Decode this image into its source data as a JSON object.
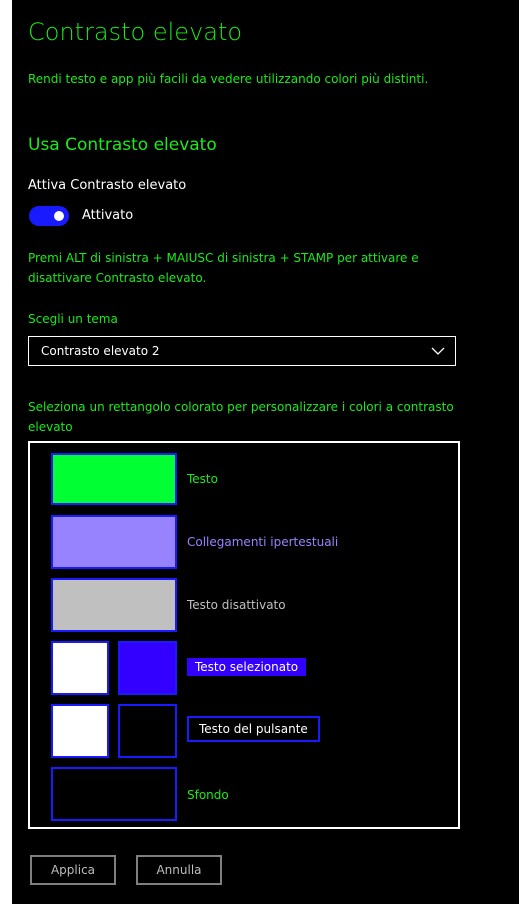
{
  "page": {
    "title": "Contrasto elevato",
    "subtitle": "Rendi testo e app più facili da vedere utilizzando colori più distinti."
  },
  "section": {
    "title": "Usa Contrasto elevato",
    "toggle_label": "Attiva Contrasto elevato",
    "toggle_state": "Attivato",
    "toggle_on": true,
    "shortcut_text": "Premi ALT di sinistra + MAIUSC di sinistra + STAMP per attivare e disattivare Contrasto elevato."
  },
  "theme": {
    "label": "Scegli un tema",
    "selected": "Contrasto elevato 2"
  },
  "colors": {
    "instructions": "Seleziona un rettangolo colorato per personalizzare i colori a contrasto elevato",
    "items": [
      {
        "label": "Testo",
        "swatches": [
          "#00ff33"
        ]
      },
      {
        "label": "Collegamenti ipertestuali",
        "swatches": [
          "#9883ff"
        ]
      },
      {
        "label": "Testo disattivato",
        "swatches": [
          "#c0c0c0"
        ]
      },
      {
        "label": "Testo selezionato",
        "swatches": [
          "#ffffff",
          "#3300ff"
        ]
      },
      {
        "label": "Testo del pulsante",
        "swatches": [
          "#ffffff",
          "#000000"
        ]
      },
      {
        "label": "Sfondo",
        "swatches": [
          "#000000"
        ]
      }
    ]
  },
  "buttons": {
    "apply": "Applica",
    "cancel": "Annulla"
  },
  "palette": {
    "accent_green": "#1aeb1a",
    "toggle_blue": "#1a1aff",
    "link_purple": "#9883ff",
    "disabled_gray": "#c0c0c0"
  }
}
